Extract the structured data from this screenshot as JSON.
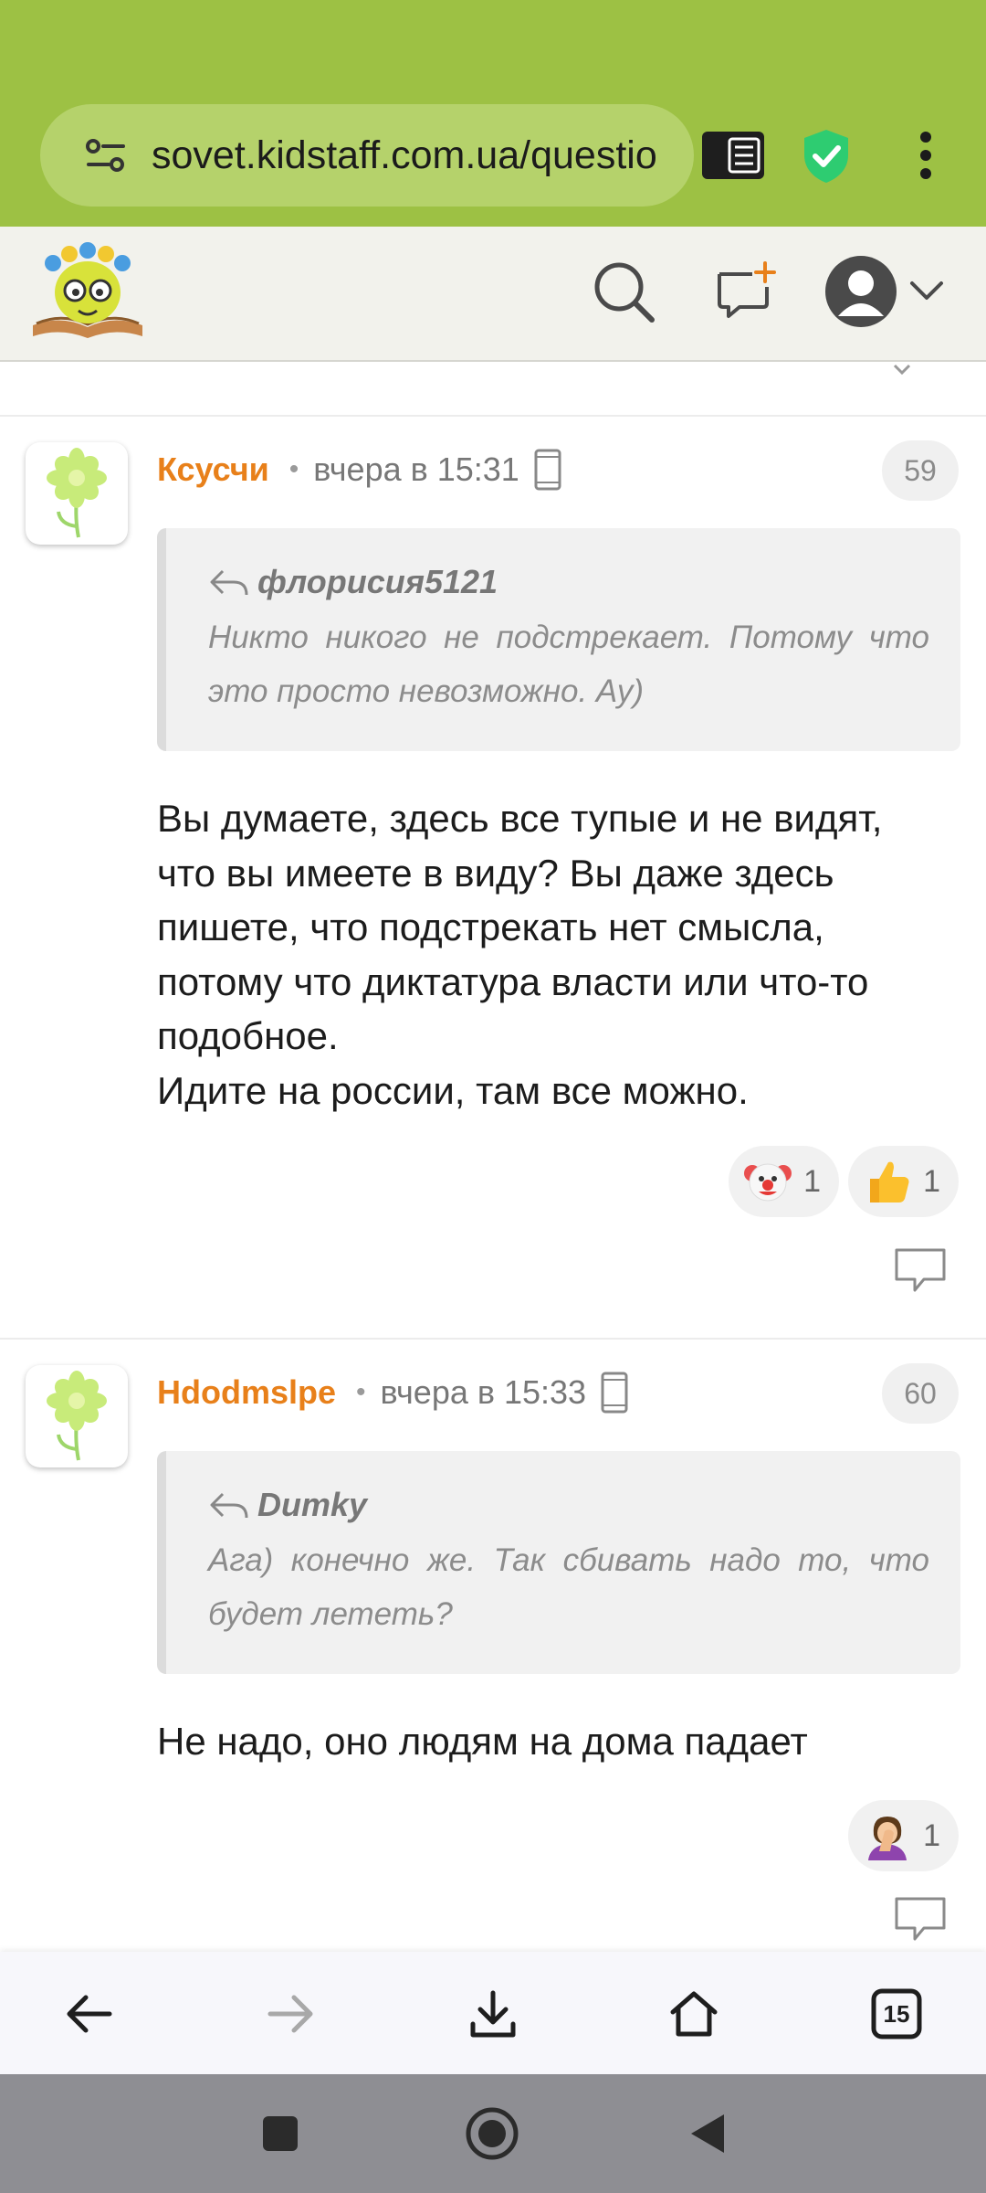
{
  "browser": {
    "url": "sovet.kidstaff.com.ua/questio",
    "tab_count": "15"
  },
  "colors": {
    "browser_bar": "#9dc144",
    "author": "#e8801a",
    "shield": "#2ecc71"
  },
  "posts": [
    {
      "author": "Ксусчи",
      "time": "вчера в 15:31",
      "number": "59",
      "quote_author": "флорисия5121",
      "quote_text": "Никто никого не подстрекает. Потому что это просто невозможно. Ау)",
      "body_lines": [
        "Вы думаете, здесь все тупые и не видят,",
        "что вы имеете в виду? Вы даже здесь",
        "пишете, что подстрекать нет смысла,",
        "потому что диктатура власти или что-то",
        "подобное.",
        "Идите на россии, там все можно."
      ],
      "reactions": [
        {
          "icon": "clown-emoji",
          "count": "1"
        },
        {
          "icon": "thumbs-up-emoji",
          "count": "1"
        }
      ]
    },
    {
      "author": "Hdodmslpe",
      "time": "вчера в 15:33",
      "number": "60",
      "quote_author": "Dumky",
      "quote_text": "Ага) конечно же. Так сбивать надо то, что будет лететь?",
      "body_lines": [
        "Не надо, оно людям на дома падает"
      ],
      "reactions": [
        {
          "icon": "facepalm-emoji",
          "count": "1"
        }
      ]
    }
  ]
}
